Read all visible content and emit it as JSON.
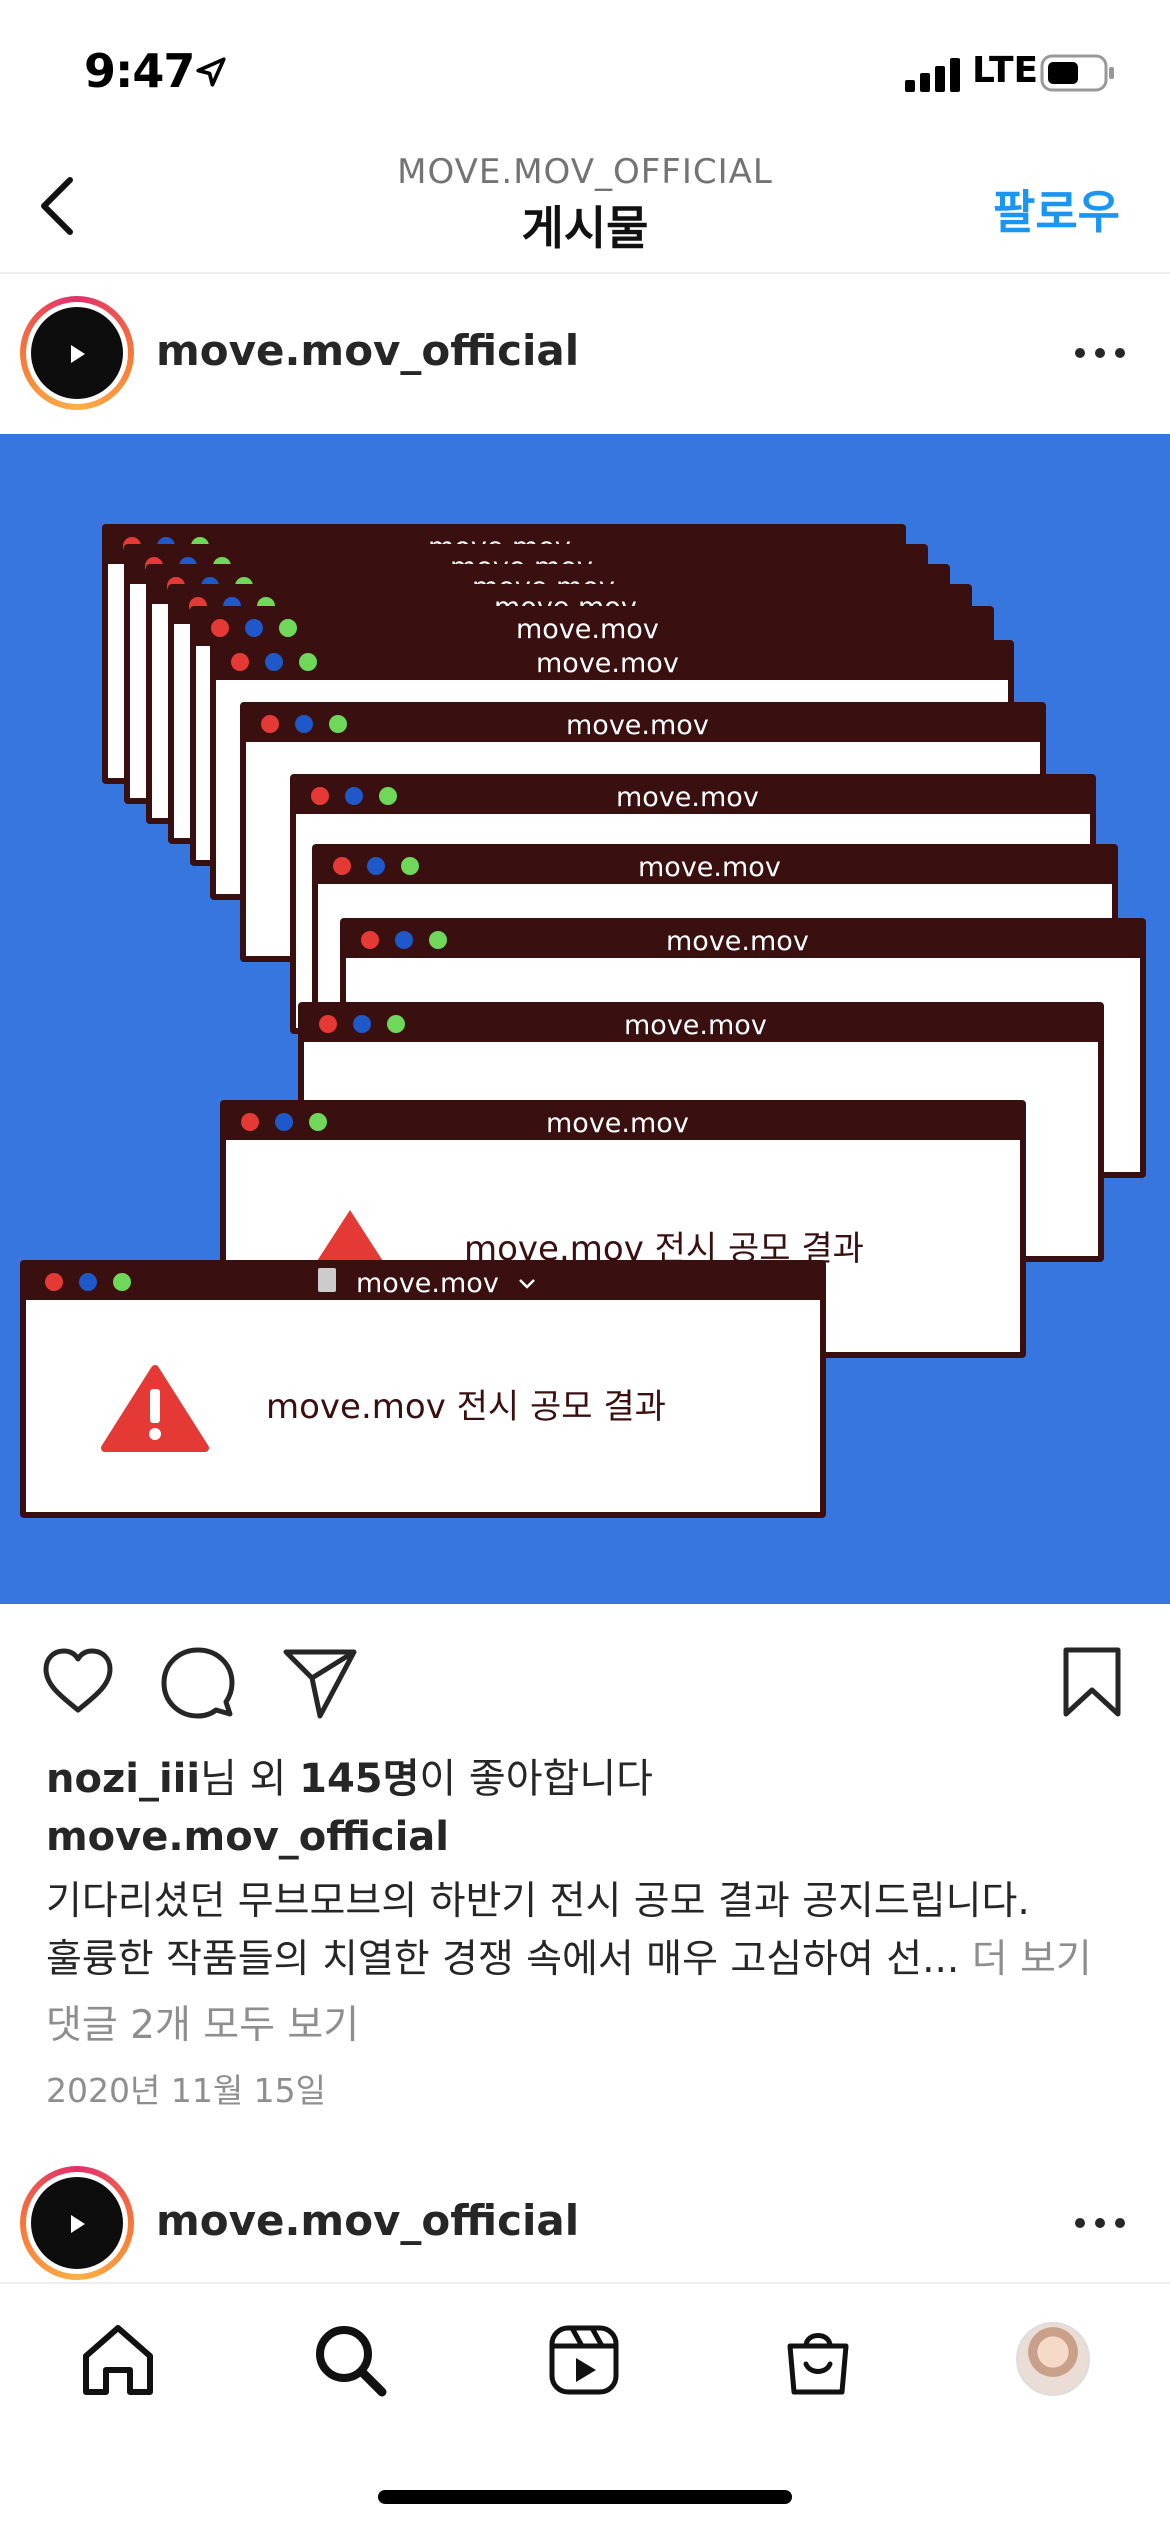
{
  "status_bar": {
    "time": "9:47",
    "network": "LTE"
  },
  "nav": {
    "subtitle": "MOVE.MOV_OFFICIAL",
    "title": "게시물",
    "follow_label": "팔로우"
  },
  "post": {
    "username": "move.mov_official",
    "image": {
      "window_title": "move.mov",
      "alert_text": "move.mov 전시 공모 결과",
      "background_color": "#3775df"
    },
    "likes": {
      "user": "nozi_iii",
      "suffix1": "님 외 ",
      "count": "145명",
      "suffix2": "이 좋아합니다"
    },
    "caption": {
      "username": "move.mov_official",
      "line1": "기다리셨던 무브모브의 하반기 전시 공모 결과 공지드립니다.",
      "line2": "훌륭한 작품들의 치열한 경쟁 속에서 매우 고심하여 선...",
      "more_label": "더 보기"
    },
    "comments_label": "댓글 2개 모두 보기",
    "date": "2020년 11월 15일"
  },
  "next_post": {
    "username": "move.mov_official"
  },
  "tab_bar": {
    "items": [
      "home-icon",
      "search-icon",
      "reels-icon",
      "shop-icon",
      "profile-avatar"
    ]
  }
}
